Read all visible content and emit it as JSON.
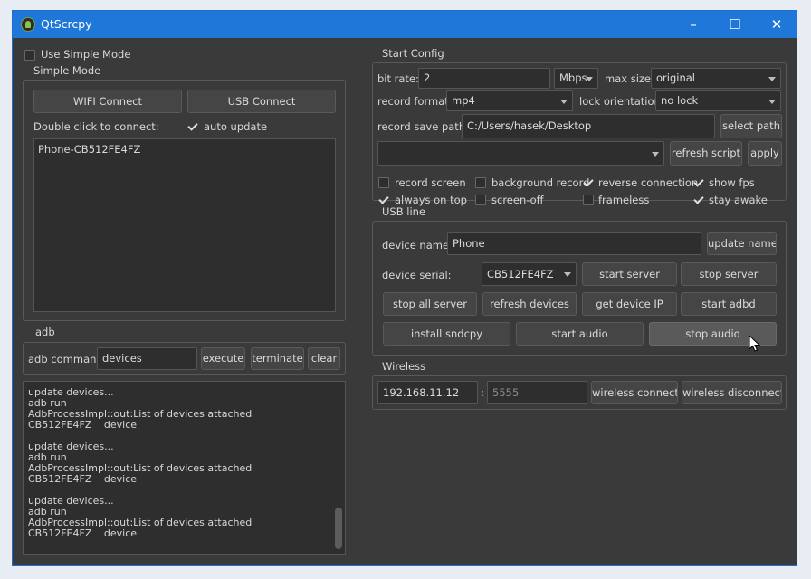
{
  "window": {
    "title": "QtScrcpy"
  },
  "simple": {
    "use_simple_mode": "Use Simple Mode",
    "group_title": "Simple Mode",
    "wifi_connect": "WIFI Connect",
    "usb_connect": "USB Connect",
    "double_click_hint": "Double click to connect:",
    "auto_update": "auto update",
    "devices": [
      "Phone-CB512FE4FZ"
    ]
  },
  "adb": {
    "group_title": "adb",
    "command_label": "adb command:",
    "command_value": "devices",
    "execute": "execute",
    "terminate": "terminate",
    "clear": "clear",
    "log": [
      "update devices...",
      "adb run",
      "AdbProcessImpl::out:List of devices attached",
      "CB512FE4FZ\tdevice",
      "",
      "update devices...",
      "adb run",
      "AdbProcessImpl::out:List of devices attached",
      "CB512FE4FZ\tdevice",
      "",
      "update devices...",
      "adb run",
      "AdbProcessImpl::out:List of devices attached",
      "CB512FE4FZ\tdevice"
    ]
  },
  "start_config": {
    "group_title": "Start Config",
    "bit_rate_label": "bit rate:",
    "bit_rate_value": "2",
    "bit_rate_unit": "Mbps",
    "max_size_label": "max size:",
    "max_size_value": "original",
    "record_format_label": "record format:",
    "record_format_value": "mp4",
    "lock_orientation_label": "lock orientation:",
    "lock_orientation_value": "no lock",
    "record_path_label": "record save path:",
    "record_path_value": "C:/Users/hasek/Desktop",
    "select_path": "select path",
    "script_value": "",
    "refresh_script": "refresh script",
    "apply": "apply",
    "options": {
      "record_screen": "record screen",
      "background_record": "background record",
      "reverse_connection": "reverse connection",
      "show_fps": "show fps",
      "always_on_top": "always on top",
      "screen_off": "screen-off",
      "frameless": "frameless",
      "stay_awake": "stay awake"
    }
  },
  "usb": {
    "group_title": "USB line",
    "device_name_label": "device name:",
    "device_name_value": "Phone",
    "update_name": "update name",
    "device_serial_label": "device serial:",
    "device_serial_value": "CB512FE4FZ",
    "start_server": "start server",
    "stop_server": "stop server",
    "stop_all_server": "stop all server",
    "refresh_devices": "refresh devices",
    "get_device_ip": "get device IP",
    "start_adbd": "start adbd",
    "install_sndcpy": "install sndcpy",
    "start_audio": "start audio",
    "stop_audio": "stop audio"
  },
  "wireless": {
    "group_title": "Wireless",
    "ip_value": "192.168.11.12",
    "separator": ":",
    "port_placeholder": "5555",
    "wireless_connect": "wireless connect",
    "wireless_disconnect": "wireless disconnect"
  }
}
